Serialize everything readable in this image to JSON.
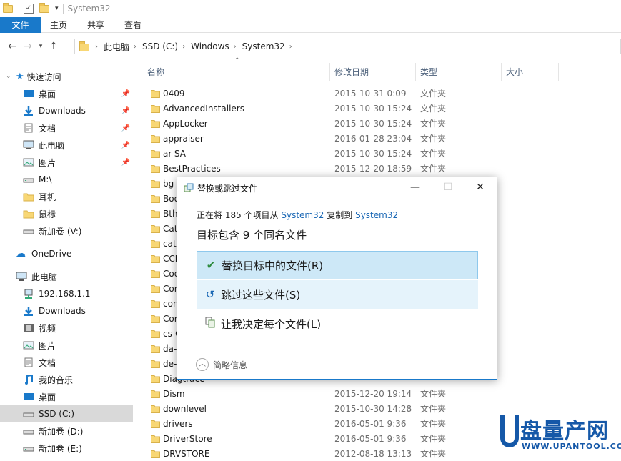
{
  "window": {
    "title": "System32"
  },
  "ribbon": {
    "tabs": [
      "文件",
      "主页",
      "共享",
      "查看"
    ]
  },
  "address": {
    "crumbs": [
      "此电脑",
      "SSD (C:)",
      "Windows",
      "System32"
    ]
  },
  "nav": {
    "quick_access": "快速访问",
    "items": [
      {
        "label": "桌面",
        "icon": "desktop-icon",
        "pinned": true
      },
      {
        "label": "Downloads",
        "icon": "download-icon",
        "pinned": true
      },
      {
        "label": "文档",
        "icon": "document-icon",
        "pinned": true
      },
      {
        "label": "此电脑",
        "icon": "computer-icon",
        "pinned": true
      },
      {
        "label": "图片",
        "icon": "picture-icon",
        "pinned": true
      },
      {
        "label": "M:\\",
        "icon": "drive-icon",
        "pinned": false
      },
      {
        "label": "耳机",
        "icon": "folder-icon",
        "pinned": false
      },
      {
        "label": "鼠标",
        "icon": "folder-icon",
        "pinned": false
      },
      {
        "label": "新加卷 (V:)",
        "icon": "drive-icon",
        "pinned": false
      }
    ],
    "onedrive": "OneDrive",
    "this_pc": "此电脑",
    "pc_items": [
      {
        "label": "192.168.1.1",
        "icon": "network-icon"
      },
      {
        "label": "Downloads",
        "icon": "download-icon"
      },
      {
        "label": "视频",
        "icon": "video-icon"
      },
      {
        "label": "图片",
        "icon": "picture-icon"
      },
      {
        "label": "文档",
        "icon": "document-icon"
      },
      {
        "label": "我的音乐",
        "icon": "music-icon"
      },
      {
        "label": "桌面",
        "icon": "desktop-icon"
      },
      {
        "label": "SSD (C:)",
        "icon": "drive-icon",
        "selected": true
      },
      {
        "label": "新加卷 (D:)",
        "icon": "drive-icon"
      },
      {
        "label": "新加卷 (E:)",
        "icon": "drive-icon"
      }
    ]
  },
  "columns": {
    "name": "名称",
    "date": "修改日期",
    "type": "类型",
    "size": "大小"
  },
  "files": [
    {
      "name": "0409",
      "date": "2015-10-31 0:09",
      "type": "文件夹"
    },
    {
      "name": "AdvancedInstallers",
      "date": "2015-10-30 15:24",
      "type": "文件夹"
    },
    {
      "name": "AppLocker",
      "date": "2015-10-30 15:24",
      "type": "文件夹"
    },
    {
      "name": "appraiser",
      "date": "2016-01-28 23:04",
      "type": "文件夹"
    },
    {
      "name": "ar-SA",
      "date": "2015-10-30 15:24",
      "type": "文件夹"
    },
    {
      "name": "BestPractices",
      "date": "2015-12-20 18:59",
      "type": "文件夹"
    },
    {
      "name": "bg-",
      "date": "",
      "type": ""
    },
    {
      "name": "Boo",
      "date": "",
      "type": ""
    },
    {
      "name": "Bth",
      "date": "",
      "type": ""
    },
    {
      "name": "Cat",
      "date": "",
      "type": ""
    },
    {
      "name": "catr",
      "date": "",
      "type": ""
    },
    {
      "name": "CCE",
      "date": "",
      "type": ""
    },
    {
      "name": "Cod",
      "date": "",
      "type": ""
    },
    {
      "name": "Con",
      "date": "",
      "type": ""
    },
    {
      "name": "con",
      "date": "",
      "type": ""
    },
    {
      "name": "Cor",
      "date": "",
      "type": ""
    },
    {
      "name": "cs-C",
      "date": "",
      "type": ""
    },
    {
      "name": "da-",
      "date": "",
      "type": ""
    },
    {
      "name": "de-",
      "date": "",
      "type": ""
    },
    {
      "name": "Diagtrace",
      "date": "",
      "type": ""
    },
    {
      "name": "Dism",
      "date": "2015-12-20 19:14",
      "type": "文件夹"
    },
    {
      "name": "downlevel",
      "date": "2015-10-30 14:28",
      "type": "文件夹"
    },
    {
      "name": "drivers",
      "date": "2016-05-01 9:36",
      "type": "文件夹"
    },
    {
      "name": "DriverStore",
      "date": "2016-05-01 9:36",
      "type": "文件夹"
    },
    {
      "name": "DRVSTORE",
      "date": "2012-08-18 13:13",
      "type": "文件夹"
    }
  ],
  "dialog": {
    "title": "替换或跳过文件",
    "info_prefix": "正在将 185 个项目从",
    "source": "System32",
    "info_mid": "复制到",
    "dest": "System32",
    "heading": "目标包含 9 个同名文件",
    "options": [
      {
        "icon": "checkmark-icon",
        "label": "替换目标中的文件(R)"
      },
      {
        "icon": "skip-icon",
        "label": "跳过这些文件(S)"
      },
      {
        "icon": "compare-icon",
        "label": "让我决定每个文件(L)"
      }
    ],
    "more": "简略信息"
  },
  "watermark": {
    "main": "盘量产网",
    "sub": "WWW.UPANTOOL.COM"
  },
  "colors": {
    "accent": "#1979ca",
    "link": "#1866b4",
    "folder": "#f8d775",
    "selection": "#cde8f7"
  }
}
